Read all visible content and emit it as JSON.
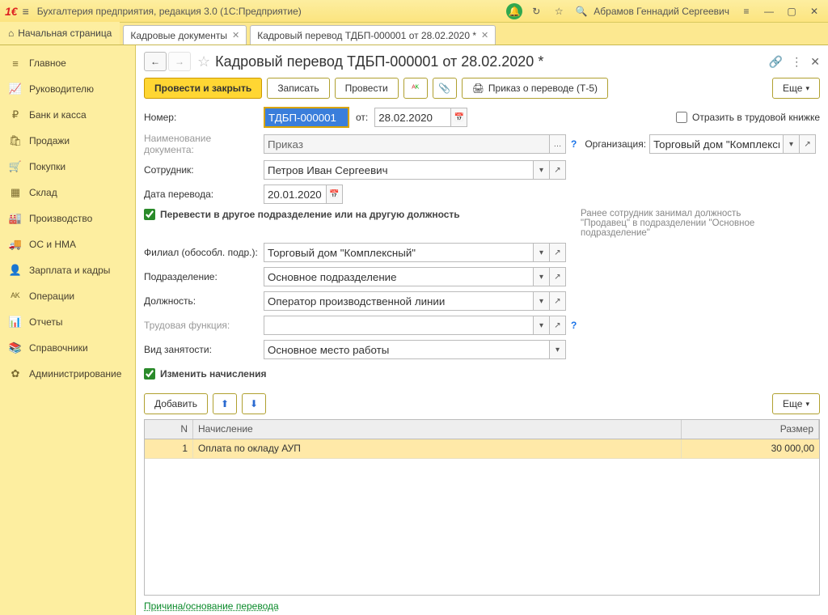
{
  "app": {
    "title": "Бухгалтерия предприятия, редакция 3.0  (1С:Предприятие)",
    "user": "Абрамов Геннадий Сергеевич"
  },
  "tabs": {
    "home": "Начальная страница",
    "t1": "Кадровые документы",
    "t2": "Кадровый перевод ТДБП-000001 от 28.02.2020 *"
  },
  "sidebar": [
    {
      "icon": "≡",
      "label": "Главное"
    },
    {
      "icon": "📈",
      "label": "Руководителю"
    },
    {
      "icon": "₽",
      "label": "Банк и касса"
    },
    {
      "icon": "🛍",
      "label": "Продажи"
    },
    {
      "icon": "🛒",
      "label": "Покупки"
    },
    {
      "icon": "▦",
      "label": "Склад"
    },
    {
      "icon": "🏭",
      "label": "Производство"
    },
    {
      "icon": "🚚",
      "label": "ОС и НМА"
    },
    {
      "icon": "👤",
      "label": "Зарплата и кадры"
    },
    {
      "icon": "ᴬᴷ",
      "label": "Операции"
    },
    {
      "icon": "📊",
      "label": "Отчеты"
    },
    {
      "icon": "📚",
      "label": "Справочники"
    },
    {
      "icon": "✿",
      "label": "Администрирование"
    }
  ],
  "doc": {
    "title": "Кадровый перевод ТДБП-000001 от 28.02.2020 *",
    "toolbar": {
      "post_close": "Провести и закрыть",
      "save": "Записать",
      "post": "Провести",
      "print": "Приказ о переводе (Т-5)",
      "more": "Еще"
    },
    "labels": {
      "number": "Номер:",
      "from": "от:",
      "reflect": "Отразить в трудовой книжке",
      "docname": "Наименование документа:",
      "org": "Организация:",
      "employee": "Сотрудник:",
      "transfer_date": "Дата перевода:",
      "transfer_chk": "Перевести в другое подразделение или на другую должность",
      "branch": "Филиал (обособл. подр.):",
      "dept": "Подразделение:",
      "position": "Должность:",
      "function": "Трудовая функция:",
      "emp_type": "Вид занятости:",
      "change_accruals": "Изменить начисления",
      "add": "Добавить"
    },
    "values": {
      "number": "ТДБП-000001",
      "date": "28.02.2020",
      "docname": "Приказ",
      "org": "Торговый дом \"Комплексный\"",
      "employee": "Петров Иван Сергеевич",
      "transfer_date": "20.01.2020",
      "branch": "Торговый дом \"Комплексный\"",
      "dept": "Основное подразделение",
      "position": "Оператор производственной линии",
      "function": "",
      "emp_type": "Основное место работы"
    },
    "hint": "Ранее сотрудник занимал должность \"Продавец\" в подразделении \"Основное подразделение\"",
    "table": {
      "cols": {
        "n": "N",
        "name": "Начисление",
        "sum": "Размер"
      },
      "rows": [
        {
          "n": "1",
          "name": "Оплата по окладу АУП",
          "sum": "30 000,00"
        }
      ]
    },
    "footer": {
      "reason": "Причина/основание перевода"
    }
  }
}
